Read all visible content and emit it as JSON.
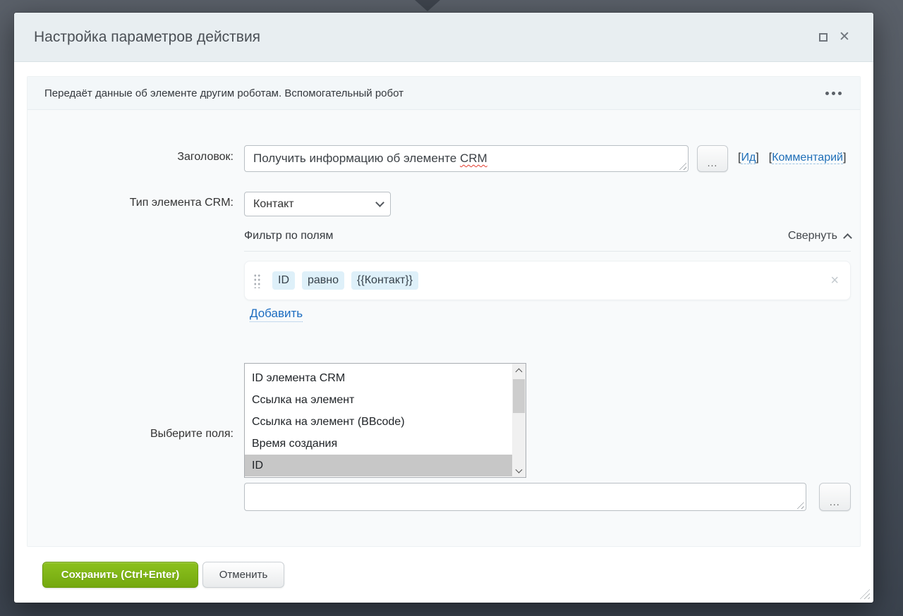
{
  "window": {
    "title": "Настройка параметров действия"
  },
  "description_bar": {
    "text": "Передаёт данные об элементе другим роботам. Вспомогательный робот"
  },
  "form": {
    "title_row": {
      "label": "Заголовок:",
      "value_text": "Получить информацию об элементе ",
      "value_misspelled": "CRM",
      "more_button": "...",
      "bracket_open": "[",
      "bracket_close": "]",
      "id_link": "Ид",
      "comment_link": "Комментарий"
    },
    "crm_type_row": {
      "label": "Тип элемента CRM:",
      "selected_value": "Контакт"
    },
    "filter": {
      "header": "Фильтр по полям",
      "collapse_label": "Свернуть",
      "row": {
        "field": "ID",
        "operator": "равно",
        "value": "{{Контакт}}",
        "remove_icon": "×"
      },
      "add_label": "Добавить"
    },
    "fields_row": {
      "label": "Выберите поля:",
      "options": [
        "ID элемента CRM",
        "Ссылка на элемент",
        "Ссылка на элемент (BBcode)",
        "Время создания",
        "ID"
      ],
      "selected_option": "ID",
      "value": "",
      "more_button": "..."
    }
  },
  "footer": {
    "save_label": "Сохранить (Ctrl+Enter)",
    "cancel_label": "Отменить"
  },
  "colors": {
    "accent_green": "#7fb41b",
    "link_blue": "#1f6fb8",
    "chip_background": "#def0f9",
    "selected_option_background": "#c7c7c7",
    "header_background": "#e8eef1",
    "backdrop": "#4a515b",
    "spellcheck_red": "#e23b2e"
  }
}
